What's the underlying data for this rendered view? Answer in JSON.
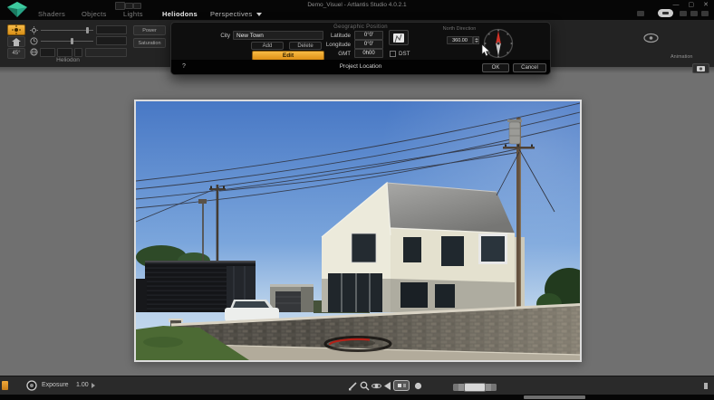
{
  "titlebar": {
    "title": "Demo_Visuel - Artlantis Studio 4.0.2.1",
    "minimize": "—",
    "maximize": "▢",
    "close": "✕"
  },
  "tabs": {
    "items": [
      {
        "label": "Shaders"
      },
      {
        "label": "Objects"
      },
      {
        "label": "Lights"
      },
      {
        "label": "Heliodons"
      },
      {
        "label": "Perspectives"
      }
    ]
  },
  "heliodon_panel": {
    "mode_45_label": "45°",
    "power_button": "Power",
    "saturation_button": "Saturation",
    "panel_label": "Heliodon"
  },
  "dialog": {
    "header": "Geographic Position",
    "city_label": "City",
    "city_value": "New Town",
    "add_button": "Add",
    "delete_button": "Delete",
    "edit_button": "Edit",
    "latitude_label": "Latitude",
    "latitude_value": "0°0'",
    "longitude_label": "Longitude",
    "longitude_value": "0°0'",
    "gmt_label": "GMT",
    "gmt_value": "0h00",
    "dst_label": "DST",
    "north_label": "North Direction",
    "north_value": "360.00",
    "help": "?",
    "footer_title": "Project Location",
    "ok_button": "OK",
    "cancel_button": "Cancel"
  },
  "right_toolbar": {
    "animation_label": "Animation"
  },
  "bottom_bar": {
    "exposure_label": "Exposure",
    "exposure_value": "1.00"
  },
  "colors": {
    "accent_orange": "#eba33b",
    "needle_red": "#d23227",
    "logo_teal": "#35b596"
  }
}
